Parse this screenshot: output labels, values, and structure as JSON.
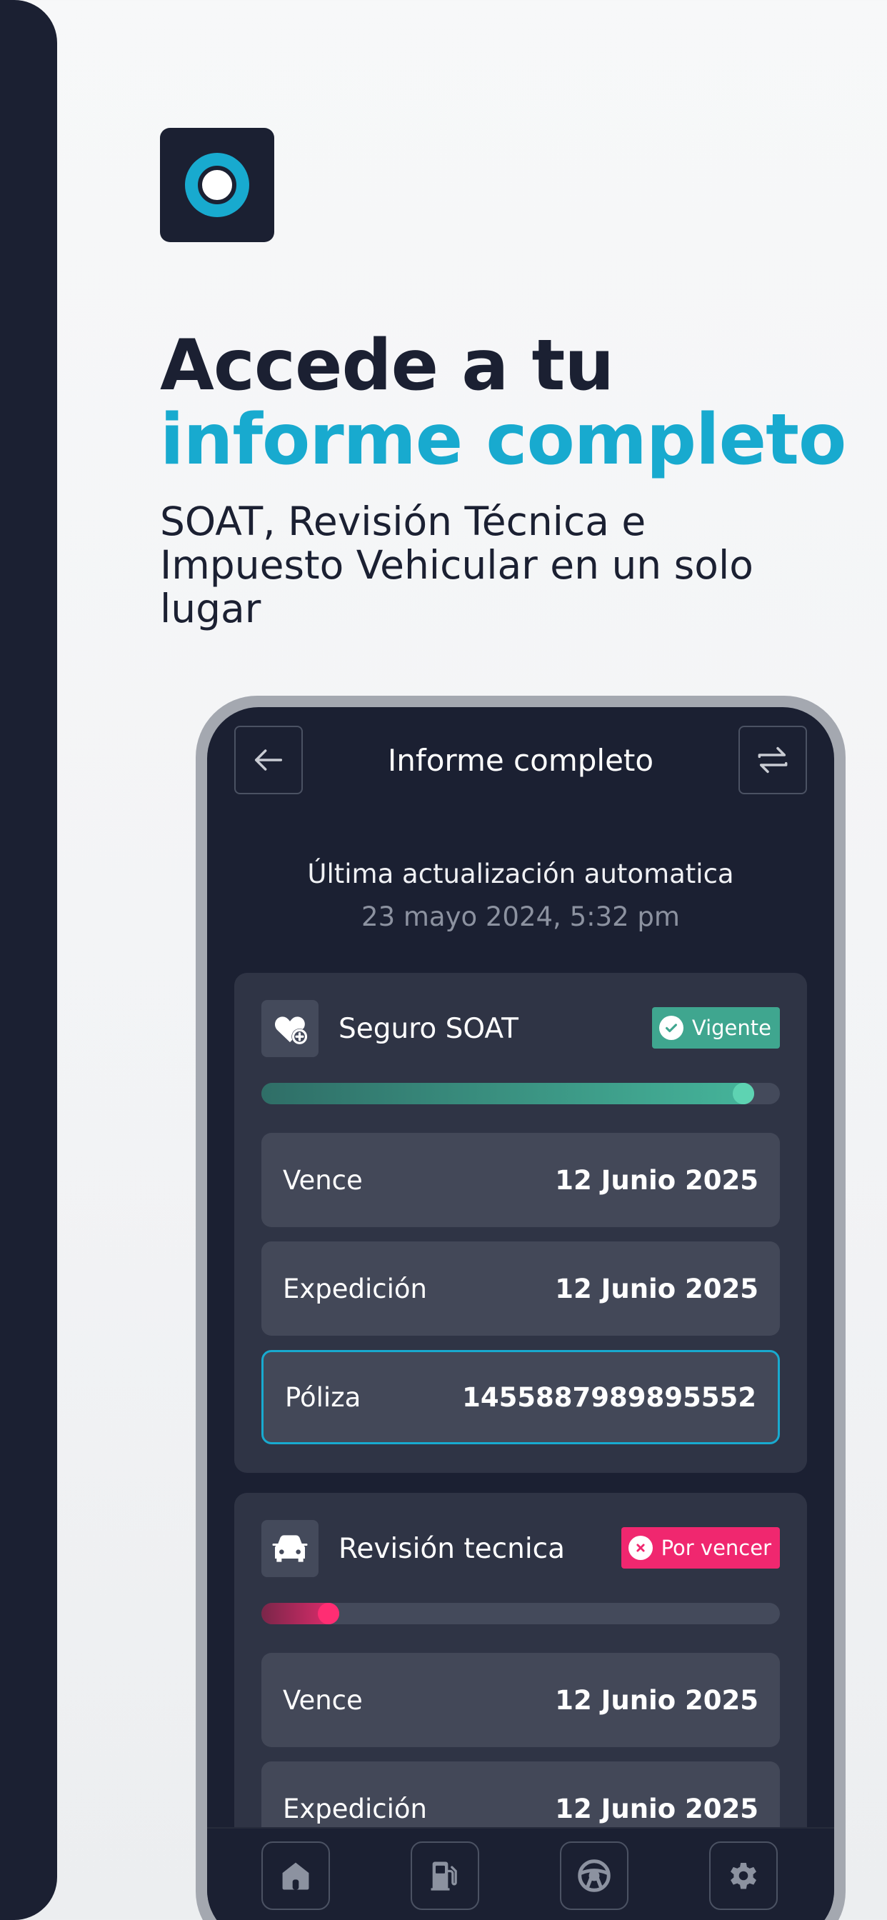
{
  "headline": {
    "line1": "Accede a tu",
    "line2": "informe completo"
  },
  "subtitle": "SOAT, Revisión Técnica e Impuesto Vehicular en un solo lugar",
  "app": {
    "title": "Informe completo",
    "last_update_label": "Última actualización automatica",
    "last_update_date": "23 mayo 2024, 5:32 pm"
  },
  "cards": {
    "soat": {
      "title": "Seguro SOAT",
      "badge": "Vigente",
      "progress": 0.95,
      "rows": [
        {
          "label": "Vence",
          "value": "12 Junio 2025"
        },
        {
          "label": "Expedición",
          "value": "12 Junio 2025"
        },
        {
          "label": "Póliza",
          "value": "1455887989895552"
        }
      ]
    },
    "rev": {
      "title": "Revisión tecnica",
      "badge": "Por vencer",
      "progress": 0.15,
      "rows": [
        {
          "label": "Vence",
          "value": "12 Junio 2025"
        },
        {
          "label": "Expedición",
          "value": "12 Junio 2025"
        }
      ]
    }
  },
  "icons": {
    "logo": "app-logo-ring",
    "back": "arrow-left-icon",
    "swap": "swap-arrows-icon",
    "soat": "heart-plus-icon",
    "rev": "car-front-icon",
    "check": "check-circle-icon",
    "close": "x-circle-icon",
    "nav": [
      "home-icon",
      "fuel-pump-icon",
      "steering-wheel-icon",
      "gear-icon"
    ]
  },
  "colors": {
    "dark": "#1b2032",
    "accent": "#18aacf",
    "ok": "#3fa68f",
    "warn": "#f0276f"
  }
}
